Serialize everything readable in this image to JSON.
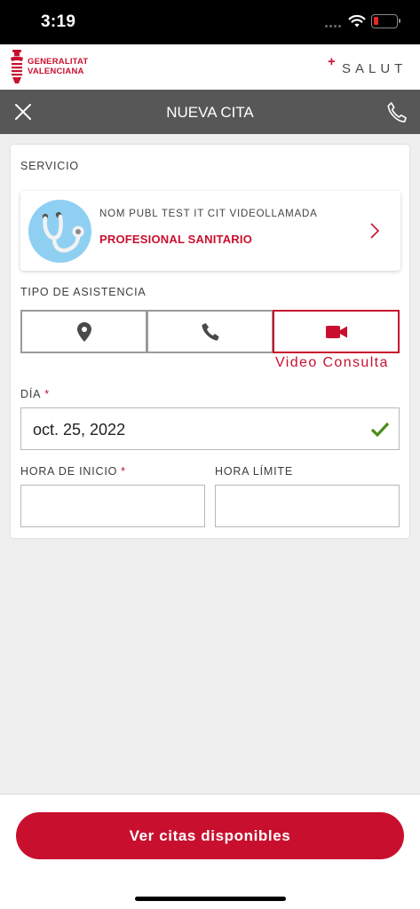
{
  "status_bar": {
    "time": "3:19",
    "icons": [
      "signal-icon",
      "wifi-icon",
      "battery-low-icon"
    ]
  },
  "brand": {
    "gv_line1": "GENERALITAT",
    "gv_line2": "VALENCIANA",
    "salut_plus": "+",
    "salut": "SALUT",
    "accent_color": "#c8102e"
  },
  "nav": {
    "title": "NUEVA CITA",
    "left_icon": "close-icon",
    "right_icon": "phone-icon",
    "background": "#575757"
  },
  "form": {
    "service_label": "SERVICIO",
    "service": {
      "name": "NOM PUBL TEST IT CIT VIDEOLLAMADA",
      "role": "PROFESIONAL SANITARIO",
      "avatar_icon": "stethoscope-icon"
    },
    "assist_label": "TIPO DE ASISTENCIA",
    "assist_options": [
      {
        "icon": "location-pin-icon",
        "selected": false
      },
      {
        "icon": "phone-icon",
        "selected": false
      },
      {
        "icon": "video-camera-icon",
        "selected": true
      }
    ],
    "assist_selected_caption": "Video Consulta",
    "day_label": "DÍA",
    "required_mark": "*",
    "day_value": "oct. 25, 2022",
    "start_label": "HORA DE INICIO",
    "start_value": "",
    "end_label": "HORA LÍMITE",
    "end_value": ""
  },
  "footer": {
    "cta": "Ver citas disponibles"
  }
}
